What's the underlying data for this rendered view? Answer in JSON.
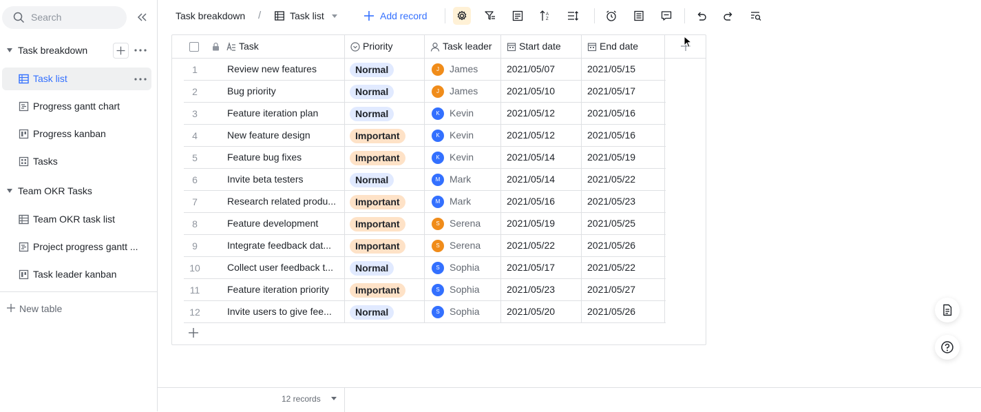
{
  "sidebar": {
    "search_placeholder": "Search",
    "groups": [
      {
        "label": "Task breakdown",
        "items": [
          {
            "label": "Task list",
            "icon": "grid-table-icon",
            "active": true
          },
          {
            "label": "Progress gantt chart",
            "icon": "gantt-icon"
          },
          {
            "label": "Progress kanban",
            "icon": "kanban-icon"
          },
          {
            "label": "Tasks",
            "icon": "gallery-icon"
          }
        ]
      },
      {
        "label": "Team OKR Tasks",
        "items": [
          {
            "label": "Team OKR task list",
            "icon": "grid-table-icon"
          },
          {
            "label": "Project progress gantt ...",
            "icon": "gantt-icon"
          },
          {
            "label": "Task leader kanban",
            "icon": "kanban-icon"
          }
        ]
      }
    ],
    "new_table": "New table"
  },
  "toolbar": {
    "breadcrumb_title": "Task breakdown",
    "separator": "/",
    "view_label": "Task list",
    "add_record": "Add record"
  },
  "table": {
    "columns": {
      "task": "Task",
      "priority": "Priority",
      "leader": "Task leader",
      "start": "Start date",
      "end": "End date"
    },
    "rows": [
      {
        "n": "1",
        "task": "Review new features",
        "priority": "Normal",
        "leader": "James",
        "initial": "J",
        "color": "#f08c1a",
        "start": "2021/05/07",
        "end": "2021/05/15"
      },
      {
        "n": "2",
        "task": "Bug priority",
        "priority": "Normal",
        "leader": "James",
        "initial": "J",
        "color": "#f08c1a",
        "start": "2021/05/10",
        "end": "2021/05/17"
      },
      {
        "n": "3",
        "task": "Feature iteration plan",
        "priority": "Normal",
        "leader": "Kevin",
        "initial": "K",
        "color": "#3370ff",
        "start": "2021/05/12",
        "end": "2021/05/16"
      },
      {
        "n": "4",
        "task": "New feature design",
        "priority": "Important",
        "leader": "Kevin",
        "initial": "K",
        "color": "#3370ff",
        "start": "2021/05/12",
        "end": "2021/05/16"
      },
      {
        "n": "5",
        "task": "Feature bug fixes",
        "priority": "Important",
        "leader": "Kevin",
        "initial": "K",
        "color": "#3370ff",
        "start": "2021/05/14",
        "end": "2021/05/19"
      },
      {
        "n": "6",
        "task": "Invite beta testers",
        "priority": "Normal",
        "leader": "Mark",
        "initial": "M",
        "color": "#3370ff",
        "start": "2021/05/14",
        "end": "2021/05/22"
      },
      {
        "n": "7",
        "task": "Research related produ...",
        "priority": "Important",
        "leader": "Mark",
        "initial": "M",
        "color": "#3370ff",
        "start": "2021/05/16",
        "end": "2021/05/23"
      },
      {
        "n": "8",
        "task": "Feature development",
        "priority": "Important",
        "leader": "Serena",
        "initial": "S",
        "color": "#f08c1a",
        "start": "2021/05/19",
        "end": "2021/05/25"
      },
      {
        "n": "9",
        "task": "Integrate feedback dat...",
        "priority": "Important",
        "leader": "Serena",
        "initial": "S",
        "color": "#f08c1a",
        "start": "2021/05/22",
        "end": "2021/05/26"
      },
      {
        "n": "10",
        "task": "Collect user feedback t...",
        "priority": "Normal",
        "leader": "Sophia",
        "initial": "S",
        "color": "#3370ff",
        "start": "2021/05/17",
        "end": "2021/05/22"
      },
      {
        "n": "11",
        "task": "Feature iteration priority",
        "priority": "Important",
        "leader": "Sophia",
        "initial": "S",
        "color": "#3370ff",
        "start": "2021/05/23",
        "end": "2021/05/27"
      },
      {
        "n": "12",
        "task": "Invite users to give fee...",
        "priority": "Normal",
        "leader": "Sophia",
        "initial": "S",
        "color": "#3370ff",
        "start": "2021/05/20",
        "end": "2021/05/26"
      }
    ]
  },
  "footer": {
    "count": "12 records"
  }
}
